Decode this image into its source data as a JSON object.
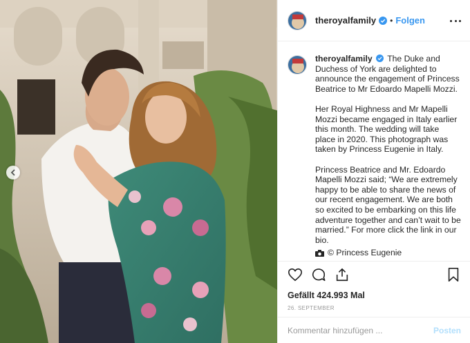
{
  "post": {
    "username": "theroyalfamily",
    "verified": true,
    "separator": "•",
    "follow_label": "Folgen",
    "caption_user": "theroyalfamily",
    "caption_paragraphs": [
      "The Duke and Duchess of York are delighted to announce the engagement of Princess Beatrice to Mr Edoardo Mapelli Mozzi.",
      "Her Royal Highness and Mr Mapelli Mozzi became engaged in Italy earlier this month. The wedding will take place in 2020. This photograph was taken by Princess Eugenie in Italy.",
      "Princess Beatrice and Mr. Edoardo Mapelli Mozzi said; “We are extremely happy to be able to share the news of our recent engagement. We are both so excited to be embarking on this life adventure together and can’t wait to be married.” For more click the link in our bio."
    ],
    "photo_credit": "© Princess Eugenie",
    "likes": "Gefällt 424.993 Mal",
    "date": "26. SEPTEMBER",
    "comment_placeholder": "Kommentar hinzufügen ...",
    "post_label": "Posten"
  },
  "icons": {
    "verified": "verified-badge-icon",
    "more": "more-options-icon",
    "like": "heart-icon",
    "comment": "comment-bubble-icon",
    "share": "share-icon",
    "save": "bookmark-icon",
    "camera": "camera-icon",
    "prev": "chevron-left-icon"
  },
  "colors": {
    "link_blue": "#3897f0",
    "post_disabled": "#b2dffc",
    "muted": "#999999",
    "border": "#efefef"
  }
}
